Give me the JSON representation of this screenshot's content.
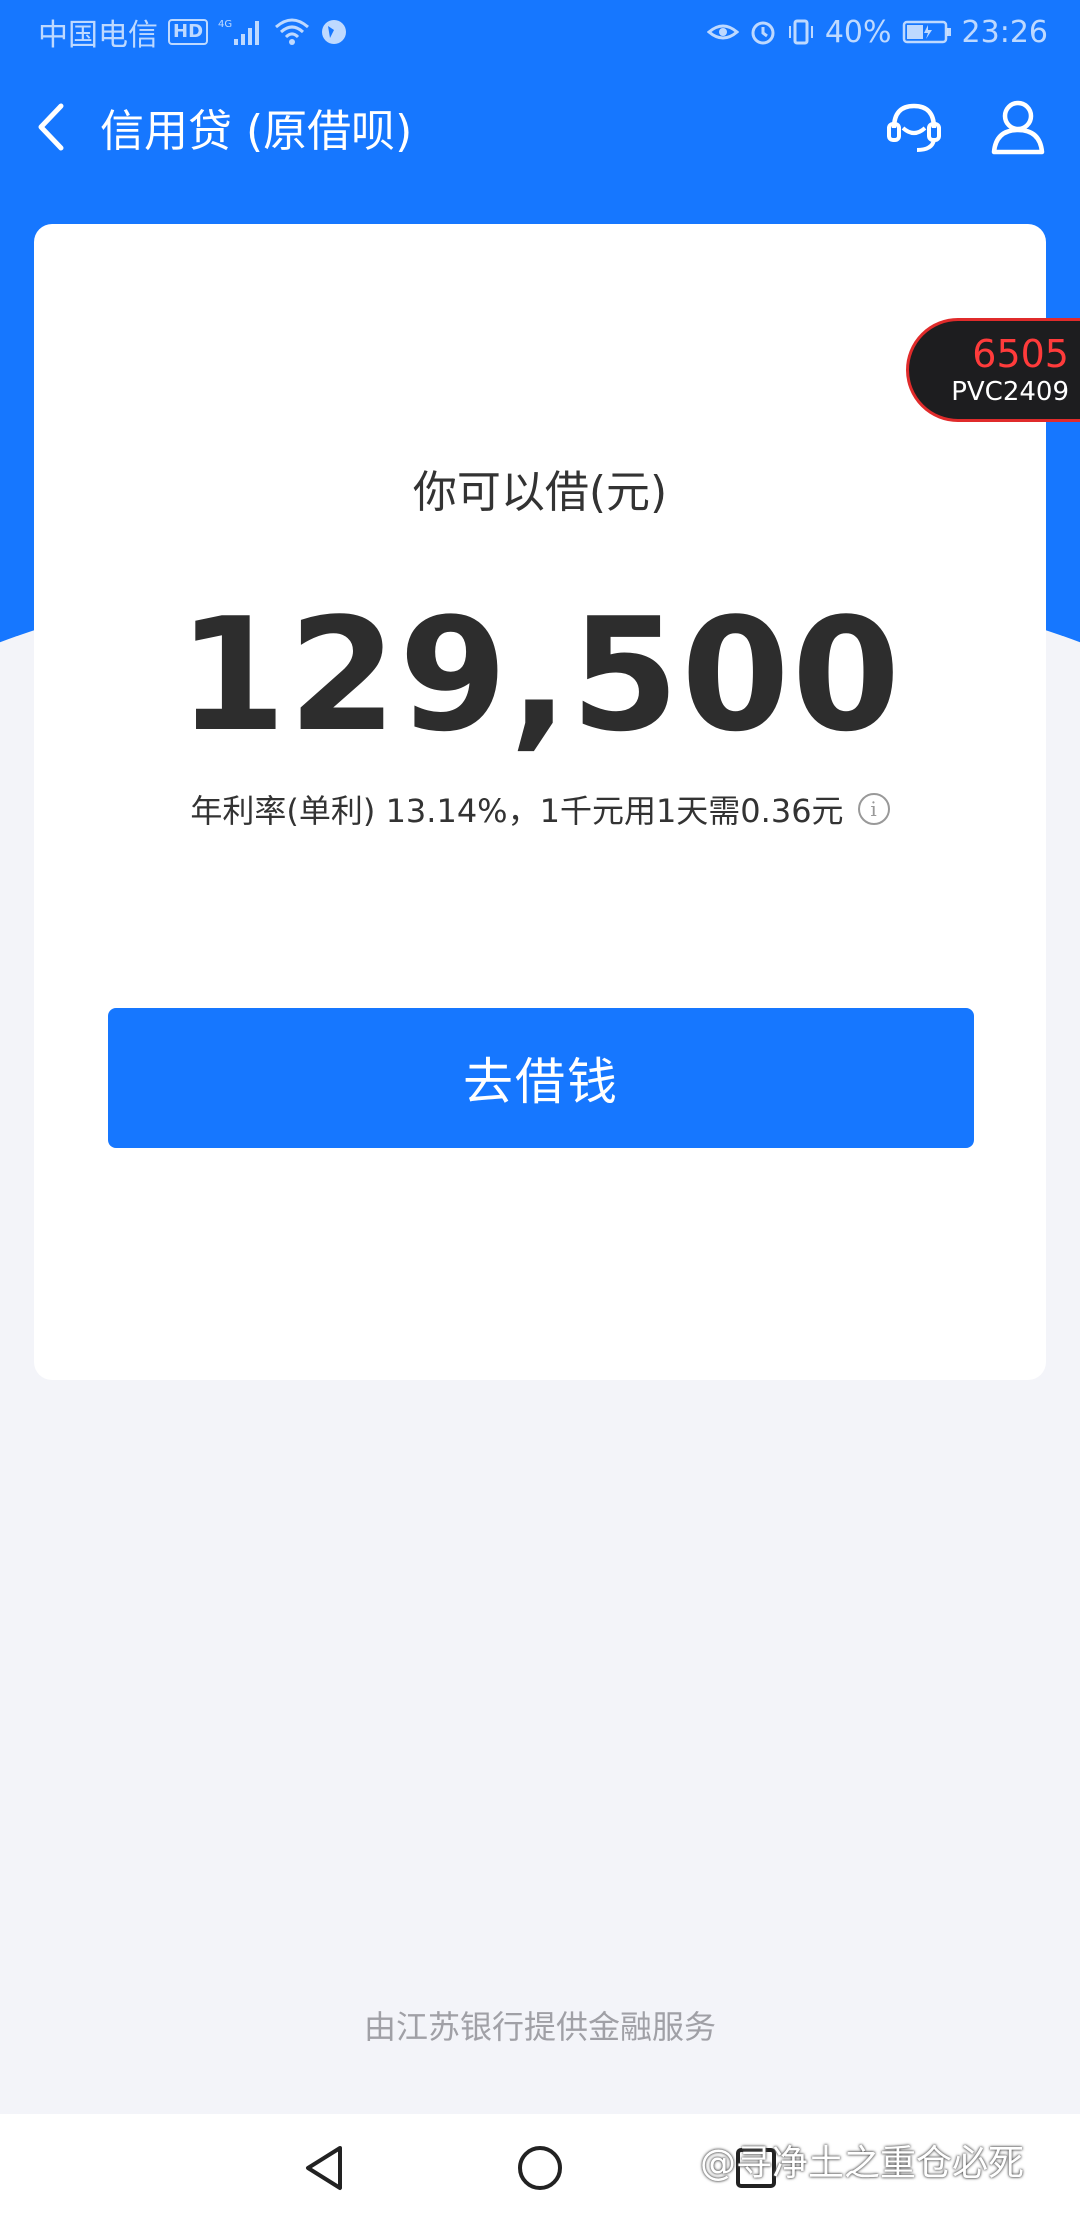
{
  "status_bar": {
    "carrier": "中国电信",
    "hd": "HD",
    "network": "4G",
    "battery": "40%",
    "time": "23:26"
  },
  "nav": {
    "title": "信用贷 (原借呗)",
    "icons": [
      "back-icon",
      "customer-service-icon",
      "user-icon"
    ]
  },
  "card": {
    "label": "你可以借(元)",
    "amount": "129,500",
    "rate_text": "年利率(单利) 13.14%，1千元用1天需0.36元",
    "button_label": "去借钱"
  },
  "floating_badge": {
    "top": "6505",
    "bottom": "PVC2409"
  },
  "footer": {
    "note": "由江苏银行提供金融服务"
  },
  "watermark": "@寻净土之重仓必死",
  "colors": {
    "primary": "#1677ff",
    "background": "#f3f4f9",
    "badge_border": "#e02b2b"
  }
}
